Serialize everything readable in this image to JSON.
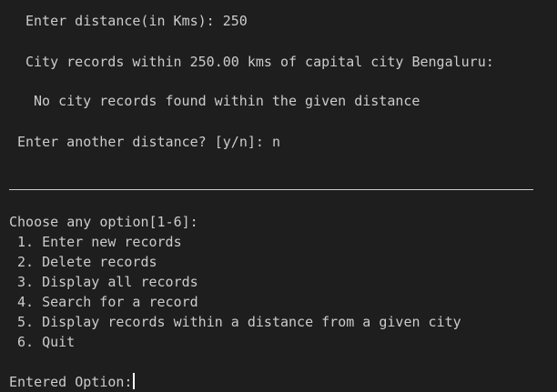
{
  "distance_prompt": "Enter distance(in Kms): 250",
  "records_header": "City records within 250.00 kms of capital city Bengaluru:",
  "no_records_msg": "No city records found within the given distance",
  "another_prompt": "Enter another distance? [y/n]: n",
  "menu": {
    "title": "Choose any option[1-6]:",
    "items": [
      "1. Enter new records",
      "2. Delete records",
      "3. Display all records",
      "4. Search for a record",
      "5. Display records within a distance from a given city",
      "6. Quit"
    ]
  },
  "option_prompt": "Entered Option:"
}
